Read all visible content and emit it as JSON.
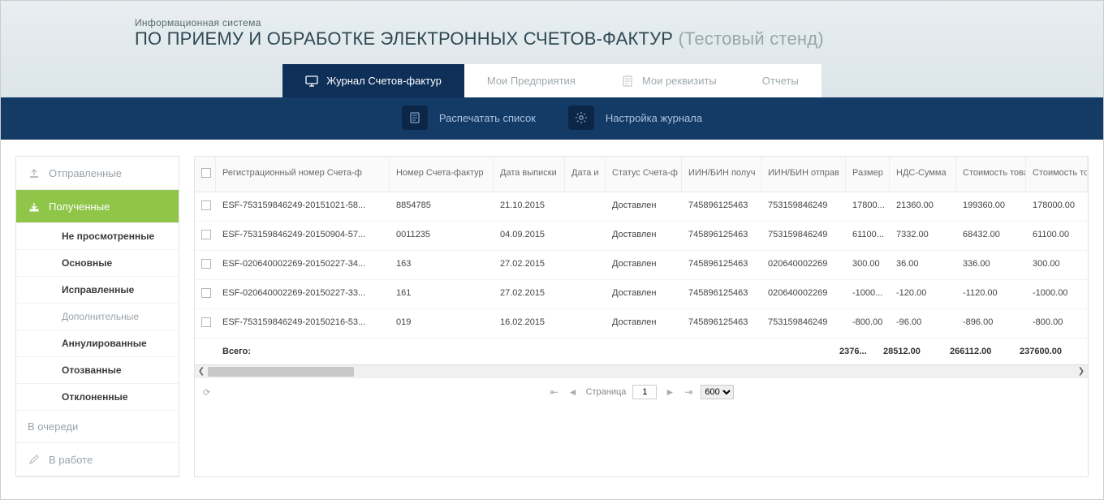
{
  "header": {
    "subtitle": "Информационная система",
    "title": "ПО ПРИЕМУ И ОБРАБОТКЕ ЭЛЕКТРОННЫХ СЧЕТОВ-ФАКТУР",
    "title_suffix": "(Тестовый стенд)"
  },
  "tabs": {
    "journal": "Журнал Счетов-фактур",
    "companies": "Мои Предприятия",
    "requisites": "Мои реквизиты",
    "reports": "Отчеты"
  },
  "toolbar": {
    "print": "Распечатать список",
    "settings": "Настройка журнала"
  },
  "sidebar": {
    "sent": "Отправленные",
    "received": "Полученные",
    "subs": {
      "unread": "Не просмотренные",
      "main": "Основные",
      "corrected": "Исправленные",
      "additional": "Дополнительные",
      "cancelled": "Аннулированные",
      "revoked": "Отозванные",
      "rejected": "Отклоненные"
    },
    "queued": "В очереди",
    "inwork": "В работе"
  },
  "columns": {
    "reg": "Регистрационный номер Счета-ф",
    "num": "Номер Счета-фактур",
    "date": "Дата выписки",
    "datei": "Дата и",
    "status": "Статус Счета-ф",
    "iin_recv": "ИИН/БИН получ",
    "iin_send": "ИИН/БИН отправ",
    "size": "Размер",
    "nds": "НДС-Сумма",
    "cost1": "Стоимость товар",
    "cost2": "Стоимость тов"
  },
  "rows": [
    {
      "reg": "ESF-753159846249-20151021-58...",
      "num": "8854785",
      "date": "21.10.2015",
      "datei": "",
      "status": "Доставлен",
      "iin_recv": "745896125463",
      "iin_send": "753159846249",
      "size": "17800...",
      "nds": "21360.00",
      "cost1": "199360.00",
      "cost2": "178000.00"
    },
    {
      "reg": "ESF-753159846249-20150904-57...",
      "num": "0011235",
      "date": "04.09.2015",
      "datei": "",
      "status": "Доставлен",
      "iin_recv": "745896125463",
      "iin_send": "753159846249",
      "size": "61100...",
      "nds": "7332.00",
      "cost1": "68432.00",
      "cost2": "61100.00"
    },
    {
      "reg": "ESF-020640002269-20150227-34...",
      "num": "163",
      "date": "27.02.2015",
      "datei": "",
      "status": "Доставлен",
      "iin_recv": "745896125463",
      "iin_send": "020640002269",
      "size": "300.00",
      "nds": "36.00",
      "cost1": "336.00",
      "cost2": "300.00"
    },
    {
      "reg": "ESF-020640002269-20150227-33...",
      "num": "161",
      "date": "27.02.2015",
      "datei": "",
      "status": "Доставлен",
      "iin_recv": "745896125463",
      "iin_send": "020640002269",
      "size": "-1000...",
      "nds": "-120.00",
      "cost1": "-1120.00",
      "cost2": "-1000.00"
    },
    {
      "reg": "ESF-753159846249-20150216-53...",
      "num": "019",
      "date": "16.02.2015",
      "datei": "",
      "status": "Доставлен",
      "iin_recv": "745896125463",
      "iin_send": "753159846249",
      "size": "-800.00",
      "nds": "-96.00",
      "cost1": "-896.00",
      "cost2": "-800.00"
    }
  ],
  "totals": {
    "label": "Всего:",
    "size": "2376...",
    "nds": "28512.00",
    "cost1": "266112.00",
    "cost2": "237600.00"
  },
  "pager": {
    "page_label": "Страница",
    "page": "1",
    "per_page": "600"
  }
}
